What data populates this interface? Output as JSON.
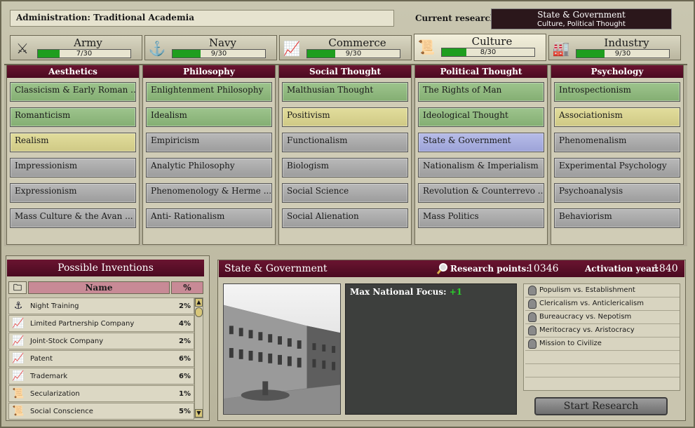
{
  "header": {
    "administration": "Administration:  Traditional Academia",
    "current_research_label": "Current research:",
    "current_research_title": "State & Government",
    "current_research_sub": "Culture, Political Thought"
  },
  "tabs": [
    {
      "name": "Army",
      "progress": "7/30",
      "value": 7,
      "max": 30,
      "icon": "crossed-swords-icon"
    },
    {
      "name": "Navy",
      "progress": "9/30",
      "value": 9,
      "max": 30,
      "icon": "anchor-icon"
    },
    {
      "name": "Commerce",
      "progress": "9/30",
      "value": 9,
      "max": 30,
      "icon": "chart-icon"
    },
    {
      "name": "Culture",
      "progress": "8/30",
      "value": 8,
      "max": 30,
      "icon": "scroll-icon"
    },
    {
      "name": "Industry",
      "progress": "9/30",
      "value": 9,
      "max": 30,
      "icon": "factory-icon"
    }
  ],
  "columns": [
    {
      "title": "Aesthetics",
      "techs": [
        {
          "name": "Classicism & Early Roman ...",
          "state": "done"
        },
        {
          "name": "Romanticism",
          "state": "done"
        },
        {
          "name": "Realism",
          "state": "prog"
        },
        {
          "name": "Impressionism",
          "state": "no"
        },
        {
          "name": "Expressionism",
          "state": "no"
        },
        {
          "name": "Mass Culture & the Avan ...",
          "state": "no"
        }
      ]
    },
    {
      "title": "Philosophy",
      "techs": [
        {
          "name": "Enlightenment Philosophy",
          "state": "done"
        },
        {
          "name": "Idealism",
          "state": "done"
        },
        {
          "name": "Empiricism",
          "state": "no"
        },
        {
          "name": "Analytic Philosophy",
          "state": "no"
        },
        {
          "name": "Phenomenology & Herme ...",
          "state": "no"
        },
        {
          "name": "Anti- Rationalism",
          "state": "no"
        }
      ]
    },
    {
      "title": "Social Thought",
      "techs": [
        {
          "name": "Malthusian Thought",
          "state": "done"
        },
        {
          "name": "Positivism",
          "state": "prog"
        },
        {
          "name": "Functionalism",
          "state": "no"
        },
        {
          "name": "Biologism",
          "state": "no"
        },
        {
          "name": "Social Science",
          "state": "no"
        },
        {
          "name": "Social Alienation",
          "state": "no"
        }
      ]
    },
    {
      "title": "Political Thought",
      "techs": [
        {
          "name": "The Rights of Man",
          "state": "done"
        },
        {
          "name": "Ideological Thought",
          "state": "done"
        },
        {
          "name": "State & Government",
          "state": "cur"
        },
        {
          "name": "Nationalism & Imperialism",
          "state": "no"
        },
        {
          "name": "Revolution & Counterrevo ...",
          "state": "no"
        },
        {
          "name": "Mass Politics",
          "state": "no"
        }
      ]
    },
    {
      "title": "Psychology",
      "techs": [
        {
          "name": "Introspectionism",
          "state": "done"
        },
        {
          "name": "Associationism",
          "state": "prog"
        },
        {
          "name": "Phenomenalism",
          "state": "no"
        },
        {
          "name": "Experimental Psychology",
          "state": "no"
        },
        {
          "name": "Psychoanalysis",
          "state": "no"
        },
        {
          "name": "Behaviorism",
          "state": "no"
        }
      ]
    }
  ],
  "inventions": {
    "title": "Possible Inventions",
    "col_name": "Name",
    "col_pct": "%",
    "rows": [
      {
        "name": "Night Training",
        "pct": "2%",
        "icon": "anchor-icon"
      },
      {
        "name": "Limited Partnership Company",
        "pct": "4%",
        "icon": "chart-icon"
      },
      {
        "name": "Joint-Stock Company",
        "pct": "2%",
        "icon": "chart-icon"
      },
      {
        "name": "Patent",
        "pct": "6%",
        "icon": "chart-icon"
      },
      {
        "name": "Trademark",
        "pct": "6%",
        "icon": "chart-icon"
      },
      {
        "name": "Secularization",
        "pct": "1%",
        "icon": "scroll-icon"
      },
      {
        "name": "Social Conscience",
        "pct": "5%",
        "icon": "scroll-icon"
      }
    ]
  },
  "detail": {
    "title": "State & Government",
    "rp_label": "Research points:",
    "rp_value": "10346",
    "act_label": "Activation year:",
    "act_value": "1840",
    "effect_label": "Max National Focus: ",
    "effect_value": "+1",
    "laws": [
      "Populism vs. Establishment",
      "Clericalism vs. Anticlericalism",
      "Bureaucracy vs. Nepotism",
      "Meritocracy vs. Aristocracy",
      "Mission to Civilize"
    ],
    "start_button": "Start Research"
  }
}
